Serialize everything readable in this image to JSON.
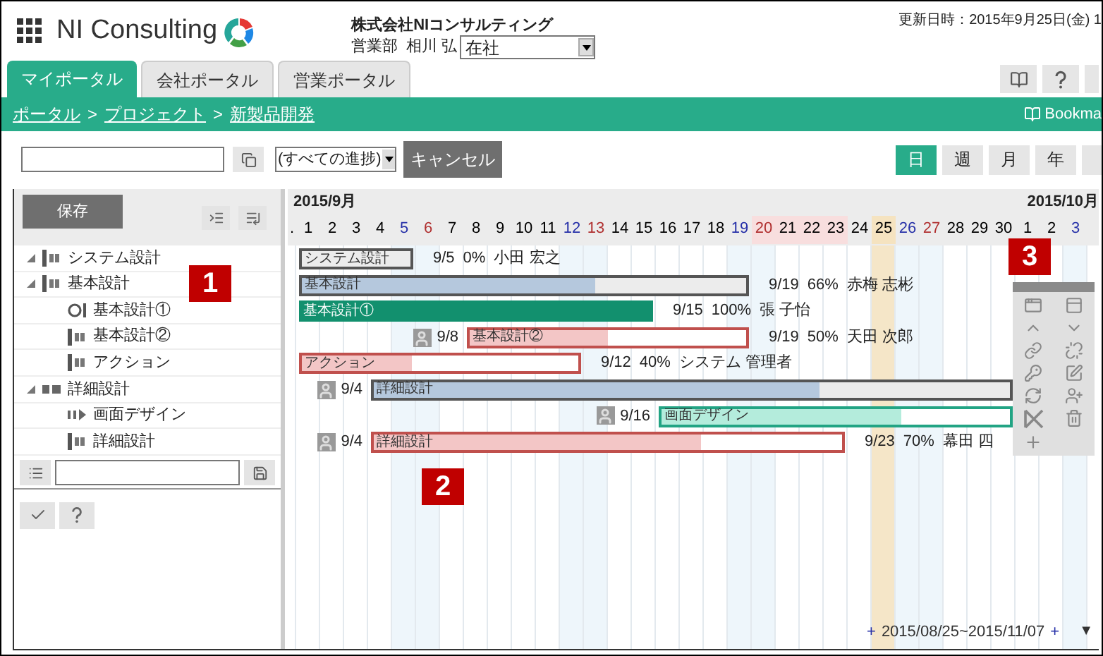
{
  "header": {
    "logo": "NI Consulting",
    "company": "株式会社NIコンサルティング",
    "department": "営業部",
    "user": "相川 弘",
    "status_select": "在社",
    "updated": "更新日時：2015年9月25日(金) 1"
  },
  "tabs": [
    {
      "label": "マイポータル",
      "selected": true
    },
    {
      "label": "会社ポータル",
      "selected": false
    },
    {
      "label": "営業ポータル",
      "selected": false
    }
  ],
  "breadcrumb": [
    "ポータル",
    "プロジェクト",
    "新製品開発"
  ],
  "breadcrumb_separator": ">",
  "bookmark": "Bookma",
  "toolbar": {
    "progress_select": "(すべての進捗)",
    "cancel": "キャンセル",
    "scales": [
      {
        "label": "日",
        "selected": true
      },
      {
        "label": "週",
        "selected": false
      },
      {
        "label": "月",
        "selected": false
      },
      {
        "label": "年",
        "selected": false
      }
    ]
  },
  "left_pane": {
    "save": "保存",
    "tree": [
      {
        "label": "システム設計",
        "kind": "task",
        "expanded": true
      },
      {
        "label": "基本設計",
        "kind": "task",
        "expanded": true,
        "children": [
          {
            "label": "基本設計①",
            "kind": "milestone"
          },
          {
            "label": "基本設計②",
            "kind": "task"
          },
          {
            "label": "アクション",
            "kind": "task"
          }
        ]
      },
      {
        "label": "詳細設計",
        "kind": "group",
        "expanded": true,
        "children": [
          {
            "label": "画面デザイン",
            "kind": "pending"
          },
          {
            "label": "詳細設計",
            "kind": "task"
          }
        ]
      }
    ]
  },
  "gantt": {
    "months": [
      "2015/9月",
      "2015/10月"
    ],
    "days": [
      {
        "label": ".",
        "kind": "lead"
      },
      {
        "label": "1",
        "kind": "weekday"
      },
      {
        "label": "2",
        "kind": "weekday"
      },
      {
        "label": "3",
        "kind": "weekday"
      },
      {
        "label": "4",
        "kind": "weekday"
      },
      {
        "label": "5",
        "kind": "saturday"
      },
      {
        "label": "6",
        "kind": "sunday"
      },
      {
        "label": "7",
        "kind": "weekday"
      },
      {
        "label": "8",
        "kind": "weekday"
      },
      {
        "label": "9",
        "kind": "weekday"
      },
      {
        "label": "10",
        "kind": "weekday"
      },
      {
        "label": "11",
        "kind": "weekday"
      },
      {
        "label": "12",
        "kind": "saturday"
      },
      {
        "label": "13",
        "kind": "sunday"
      },
      {
        "label": "14",
        "kind": "weekday"
      },
      {
        "label": "15",
        "kind": "weekday"
      },
      {
        "label": "16",
        "kind": "weekday"
      },
      {
        "label": "17",
        "kind": "weekday"
      },
      {
        "label": "18",
        "kind": "weekday"
      },
      {
        "label": "19",
        "kind": "saturday"
      },
      {
        "label": "20",
        "kind": "sunholiday"
      },
      {
        "label": "21",
        "kind": "holiday"
      },
      {
        "label": "22",
        "kind": "holiday"
      },
      {
        "label": "23",
        "kind": "holiday"
      },
      {
        "label": "24",
        "kind": "weekday"
      },
      {
        "label": "25",
        "kind": "today"
      },
      {
        "label": "26",
        "kind": "saturday"
      },
      {
        "label": "27",
        "kind": "sunday"
      },
      {
        "label": "28",
        "kind": "weekday"
      },
      {
        "label": "29",
        "kind": "weekday"
      },
      {
        "label": "30",
        "kind": "weekday"
      },
      {
        "label": "1",
        "kind": "weekday"
      },
      {
        "label": "2",
        "kind": "weekday"
      },
      {
        "label": "3",
        "kind": "saturday"
      }
    ],
    "rows": [
      {
        "label": "システム設計",
        "kind": "summary",
        "level": 0,
        "end_label": "9/5",
        "percent": "0%",
        "owner": "小田 宏之"
      },
      {
        "label": "基本設計",
        "kind": "summary",
        "level": 0.66,
        "end_label": "9/19",
        "percent": "66%",
        "owner": "赤梅 志彬"
      },
      {
        "label": "基本設計①",
        "kind": "complete",
        "level": 1,
        "end_label": "9/15",
        "percent": "100%",
        "owner": "張 子怡"
      },
      {
        "label": "基本設計②",
        "kind": "late",
        "level": 0.5,
        "start_label": "9/8",
        "end_label": "9/19",
        "percent": "50%",
        "owner": "天田 次郎"
      },
      {
        "label": "アクション",
        "kind": "late",
        "level": 0.4,
        "end_label": "9/12",
        "percent": "40%",
        "owner": "システム 管理者"
      },
      {
        "label": "詳細設計",
        "kind": "summary",
        "level": 0.7,
        "start_label": "9/4"
      },
      {
        "label": "画面デザイン",
        "kind": "active",
        "level": 0.69,
        "start_label": "9/16"
      },
      {
        "label": "詳細設計",
        "kind": "late",
        "level": 0.7,
        "start_label": "9/4",
        "end_label": "9/23",
        "percent": "70%",
        "owner": "幕田 四"
      }
    ],
    "range": "2015/08/25~2015/11/07",
    "range_prev": "+",
    "range_next": "+",
    "more": "▼"
  },
  "callouts": [
    "1",
    "2",
    "3"
  ]
}
